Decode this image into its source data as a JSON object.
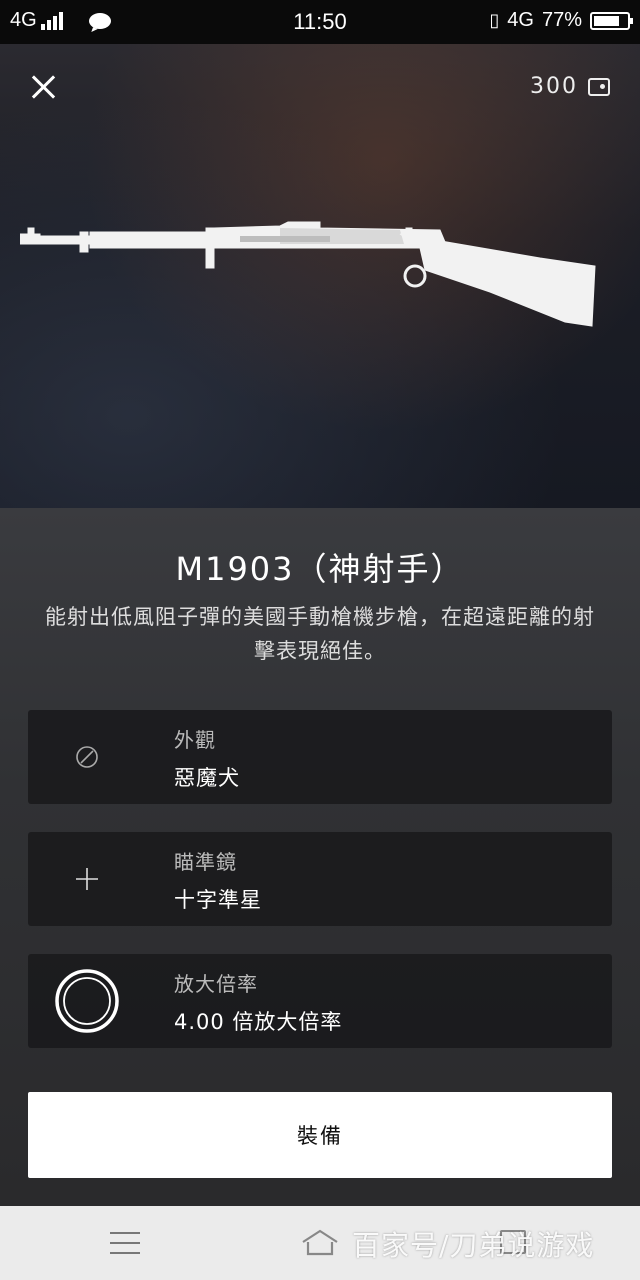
{
  "status_bar": {
    "network_left": "4G",
    "time": "11:50",
    "network_right": "4G",
    "battery": "77%",
    "battery_level": 0.77
  },
  "header": {
    "currency_amount": "300"
  },
  "weapon": {
    "name": "M1903（神射手）",
    "description": "能射出低風阻子彈的美國手動槍機步槍，在超遠距離的射擊表現絕佳。"
  },
  "options": [
    {
      "label": "外觀",
      "value": "惡魔犬",
      "icon": "disabled-circle-icon"
    },
    {
      "label": "瞄準鏡",
      "value": "十字準星",
      "icon": "crosshair-icon"
    },
    {
      "label": "放大倍率",
      "value": "4.00 倍放大倍率",
      "icon": "magnification-ring-icon"
    }
  ],
  "equip_button_label": "裝備",
  "watermark": "百家号/刀弟说游戏"
}
